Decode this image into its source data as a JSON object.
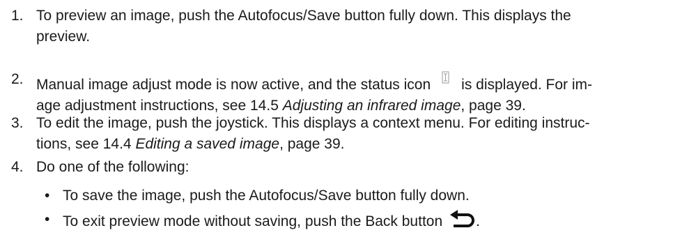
{
  "steps": [
    {
      "number": "1.",
      "line1": "To preview an image, push the Autofocus/Save button fully down. This displays the",
      "line2": "preview."
    },
    {
      "number": "2.",
      "line1_before_icon": "Manual image adjust mode is now active, and the status icon",
      "line1_after_icon": "is displayed. For im-",
      "line2_before": "age adjustment instructions, see 14.5 ",
      "line2_italic": "Adjusting an infrared image",
      "line2_after": ", page 39.",
      "icon": "manual-adjust-status-icon"
    },
    {
      "number": "3.",
      "line1": "To edit the image, push the joystick. This displays a context menu. For editing instruc-",
      "line2_before": "tions, see 14.4 ",
      "line2_italic": "Editing a saved image",
      "line2_after": ", page 39."
    },
    {
      "number": "4.",
      "line1": "Do one of the following:"
    }
  ],
  "bullets": [
    {
      "symbol": "•",
      "text": "To save the image, push the Autofocus/Save button fully down."
    },
    {
      "symbol": "•",
      "text": "To exit preview mode without saving, push the Back button",
      "suffix": ".",
      "icon": "back-arrow-icon"
    }
  ]
}
